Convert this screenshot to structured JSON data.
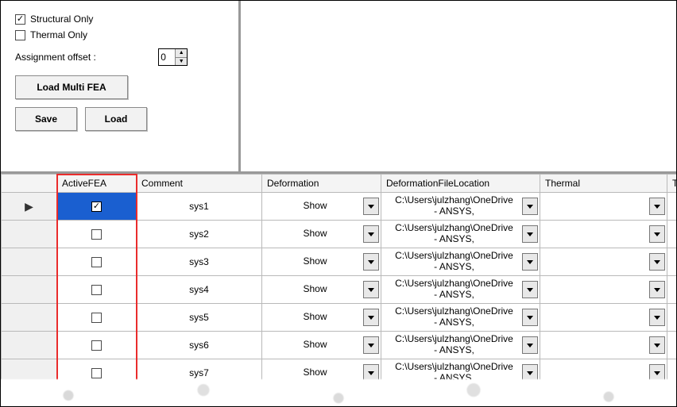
{
  "options": {
    "structural_only": {
      "label": "Structural Only",
      "checked": true
    },
    "thermal_only": {
      "label": "Thermal Only",
      "checked": false
    },
    "assignment_offset_label": "Assignment offset :",
    "assignment_offset_value": "0"
  },
  "buttons": {
    "load_multi_fea": "Load Multi FEA",
    "save": "Save",
    "load": "Load"
  },
  "grid": {
    "headers": {
      "active_fea": "ActiveFEA",
      "comment": "Comment",
      "deformation": "Deformation",
      "deformation_file_location": "DeformationFileLocation",
      "thermal": "Thermal",
      "thermal_file_location": "Then"
    },
    "row_indicator": "▶",
    "rows": [
      {
        "active": true,
        "comment": "sys1",
        "deformation": "Show",
        "def_loc_line1": "C:\\Users\\julzhang\\OneDrive",
        "def_loc_line2": "- ANSYS,",
        "thermal": ""
      },
      {
        "active": false,
        "comment": "sys2",
        "deformation": "Show",
        "def_loc_line1": "C:\\Users\\julzhang\\OneDrive",
        "def_loc_line2": "- ANSYS,",
        "thermal": ""
      },
      {
        "active": false,
        "comment": "sys3",
        "deformation": "Show",
        "def_loc_line1": "C:\\Users\\julzhang\\OneDrive",
        "def_loc_line2": "- ANSYS,",
        "thermal": ""
      },
      {
        "active": false,
        "comment": "sys4",
        "deformation": "Show",
        "def_loc_line1": "C:\\Users\\julzhang\\OneDrive",
        "def_loc_line2": "- ANSYS,",
        "thermal": ""
      },
      {
        "active": false,
        "comment": "sys5",
        "deformation": "Show",
        "def_loc_line1": "C:\\Users\\julzhang\\OneDrive",
        "def_loc_line2": "- ANSYS,",
        "thermal": ""
      },
      {
        "active": false,
        "comment": "sys6",
        "deformation": "Show",
        "def_loc_line1": "C:\\Users\\julzhang\\OneDrive",
        "def_loc_line2": "- ANSYS,",
        "thermal": ""
      },
      {
        "active": false,
        "comment": "sys7",
        "deformation": "Show",
        "def_loc_line1": "C:\\Users\\julzhang\\OneDrive",
        "def_loc_line2": "- ANSYS,",
        "thermal": ""
      }
    ]
  },
  "highlight": {
    "column": "active_fea"
  }
}
